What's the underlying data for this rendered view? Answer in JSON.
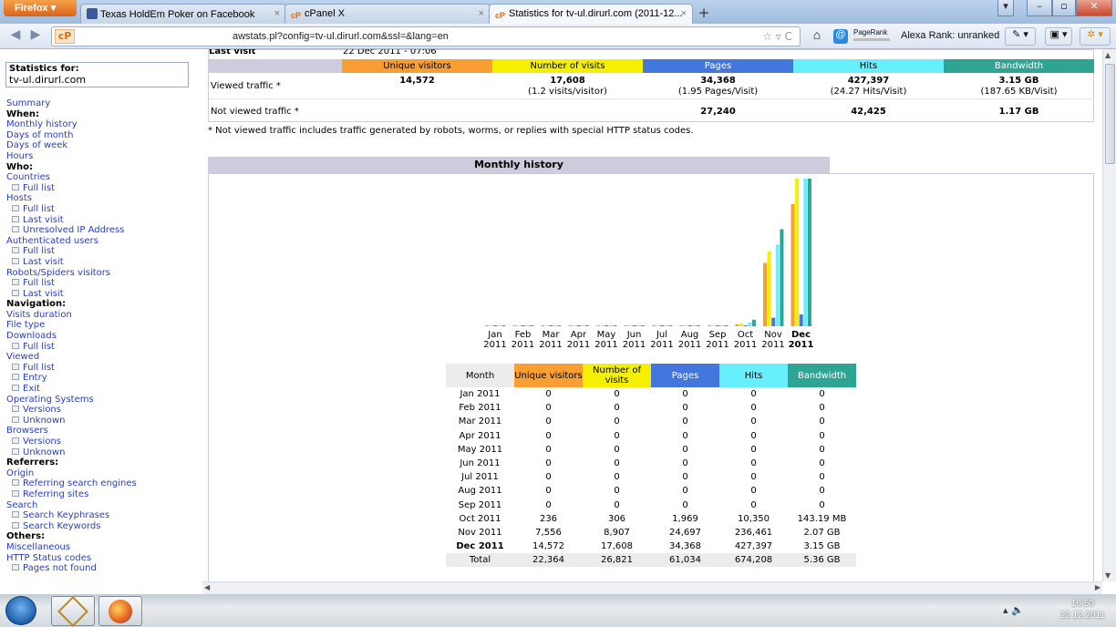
{
  "browser": {
    "app_button": "Firefox",
    "tabs": [
      {
        "label": "Texas HoldEm Poker on Facebook",
        "active": false
      },
      {
        "label": "cPanel X",
        "active": false
      },
      {
        "label": "Statistics for tv-ul.dirurl.com (2011-12...",
        "active": true
      }
    ],
    "url": "awstats.pl?config=tv-ul.dirurl.com&ssl=&lang=en",
    "pagerank_label": "PageRank",
    "alexa_label": "Alexa Rank: unranked"
  },
  "sidebar": {
    "stat_title": "Statistics for:",
    "stat_domain": "tv-ul.dirurl.com",
    "items": [
      {
        "label": "Summary",
        "type": "link"
      },
      {
        "label": "When:",
        "type": "heading"
      },
      {
        "label": "Monthly history",
        "type": "link"
      },
      {
        "label": "Days of month",
        "type": "link"
      },
      {
        "label": "Days of week",
        "type": "link"
      },
      {
        "label": "Hours",
        "type": "link"
      },
      {
        "label": "Who:",
        "type": "heading"
      },
      {
        "label": "Countries",
        "type": "link"
      },
      {
        "label": "Full list",
        "type": "sub"
      },
      {
        "label": "Hosts",
        "type": "link"
      },
      {
        "label": "Full list",
        "type": "sub"
      },
      {
        "label": "Last visit",
        "type": "sub"
      },
      {
        "label": "Unresolved IP Address",
        "type": "sub"
      },
      {
        "label": "Authenticated users",
        "type": "link"
      },
      {
        "label": "Full list",
        "type": "sub"
      },
      {
        "label": "Last visit",
        "type": "sub"
      },
      {
        "label": "Robots/Spiders visitors",
        "type": "link"
      },
      {
        "label": "Full list",
        "type": "sub"
      },
      {
        "label": "Last visit",
        "type": "sub"
      },
      {
        "label": "Navigation:",
        "type": "heading"
      },
      {
        "label": "Visits duration",
        "type": "link"
      },
      {
        "label": "File type",
        "type": "link"
      },
      {
        "label": "Downloads",
        "type": "link"
      },
      {
        "label": "Full list",
        "type": "sub"
      },
      {
        "label": "Viewed",
        "type": "link"
      },
      {
        "label": "Full list",
        "type": "sub"
      },
      {
        "label": "Entry",
        "type": "sub"
      },
      {
        "label": "Exit",
        "type": "sub"
      },
      {
        "label": "Operating Systems",
        "type": "link"
      },
      {
        "label": "Versions",
        "type": "sub"
      },
      {
        "label": "Unknown",
        "type": "sub"
      },
      {
        "label": "Browsers",
        "type": "link"
      },
      {
        "label": "Versions",
        "type": "sub"
      },
      {
        "label": "Unknown",
        "type": "sub"
      },
      {
        "label": "Referrers:",
        "type": "heading"
      },
      {
        "label": "Origin",
        "type": "link"
      },
      {
        "label": "Referring search engines",
        "type": "sub"
      },
      {
        "label": "Referring sites",
        "type": "sub"
      },
      {
        "label": "Search",
        "type": "link"
      },
      {
        "label": "Search Keyphrases",
        "type": "sub"
      },
      {
        "label": "Search Keywords",
        "type": "sub"
      },
      {
        "label": "Others:",
        "type": "heading"
      },
      {
        "label": "Miscellaneous",
        "type": "link"
      },
      {
        "label": "HTTP Status codes",
        "type": "link"
      },
      {
        "label": "Pages not found",
        "type": "sub"
      }
    ]
  },
  "summary": {
    "last_visit_label": "Last visit",
    "last_visit_value": "22 Dec 2011 - 07:06",
    "headers": [
      "Unique visitors",
      "Number of visits",
      "Pages",
      "Hits",
      "Bandwidth"
    ],
    "viewed_label": "Viewed traffic *",
    "viewed": [
      {
        "main": "14,572",
        "sub": ""
      },
      {
        "main": "17,608",
        "sub": "(1.2 visits/visitor)"
      },
      {
        "main": "34,368",
        "sub": "(1.95 Pages/Visit)"
      },
      {
        "main": "427,397",
        "sub": "(24.27 Hits/Visit)"
      },
      {
        "main": "3.15 GB",
        "sub": "(187.65 KB/Visit)"
      }
    ],
    "not_viewed_label": "Not viewed traffic *",
    "not_viewed": [
      "",
      "",
      "27,240",
      "42,425",
      "1.17 GB"
    ],
    "footnote": "* Not viewed traffic includes traffic generated by robots, worms, or replies with special HTTP status codes."
  },
  "colors": {
    "unique": "#f89e33",
    "visits": "#f4f000",
    "pages": "#4477dd",
    "hits": "#66f0ff",
    "bandwidth": "#2ea495",
    "section": "#ccccdd"
  },
  "monthly": {
    "title": "Monthly history",
    "table_headers": [
      "Month",
      "Unique visitors",
      "Number of visits",
      "Pages",
      "Hits",
      "Bandwidth"
    ],
    "rows": [
      {
        "month": "Jan 2011",
        "unique": "0",
        "visits": "0",
        "pages": "0",
        "hits": "0",
        "bw": "0",
        "current": false
      },
      {
        "month": "Feb 2011",
        "unique": "0",
        "visits": "0",
        "pages": "0",
        "hits": "0",
        "bw": "0",
        "current": false
      },
      {
        "month": "Mar 2011",
        "unique": "0",
        "visits": "0",
        "pages": "0",
        "hits": "0",
        "bw": "0",
        "current": false
      },
      {
        "month": "Apr 2011",
        "unique": "0",
        "visits": "0",
        "pages": "0",
        "hits": "0",
        "bw": "0",
        "current": false
      },
      {
        "month": "May 2011",
        "unique": "0",
        "visits": "0",
        "pages": "0",
        "hits": "0",
        "bw": "0",
        "current": false
      },
      {
        "month": "Jun 2011",
        "unique": "0",
        "visits": "0",
        "pages": "0",
        "hits": "0",
        "bw": "0",
        "current": false
      },
      {
        "month": "Jul 2011",
        "unique": "0",
        "visits": "0",
        "pages": "0",
        "hits": "0",
        "bw": "0",
        "current": false
      },
      {
        "month": "Aug 2011",
        "unique": "0",
        "visits": "0",
        "pages": "0",
        "hits": "0",
        "bw": "0",
        "current": false
      },
      {
        "month": "Sep 2011",
        "unique": "0",
        "visits": "0",
        "pages": "0",
        "hits": "0",
        "bw": "0",
        "current": false
      },
      {
        "month": "Oct 2011",
        "unique": "236",
        "visits": "306",
        "pages": "1,969",
        "hits": "10,350",
        "bw": "143.19 MB",
        "current": false
      },
      {
        "month": "Nov 2011",
        "unique": "7,556",
        "visits": "8,907",
        "pages": "24,697",
        "hits": "236,461",
        "bw": "2.07 GB",
        "current": false
      },
      {
        "month": "Dec 2011",
        "unique": "14,572",
        "visits": "17,608",
        "pages": "34,368",
        "hits": "427,397",
        "bw": "3.15 GB",
        "current": true
      }
    ],
    "total": {
      "month": "Total",
      "unique": "22,364",
      "visits": "26,821",
      "pages": "61,034",
      "hits": "674,208",
      "bw": "5.36 GB"
    }
  },
  "chart_data": {
    "type": "bar",
    "categories": [
      "Jan 2011",
      "Feb 2011",
      "Mar 2011",
      "Apr 2011",
      "May 2011",
      "Jun 2011",
      "Jul 2011",
      "Aug 2011",
      "Sep 2011",
      "Oct 2011",
      "Nov 2011",
      "Dec 2011"
    ],
    "month_labels": [
      "Jan",
      "Feb",
      "Mar",
      "Apr",
      "May",
      "Jun",
      "Jul",
      "Aug",
      "Sep",
      "Oct",
      "Nov",
      "Dec"
    ],
    "year_labels": [
      "2011",
      "2011",
      "2011",
      "2011",
      "2011",
      "2011",
      "2011",
      "2011",
      "2011",
      "2011",
      "2011",
      "2011"
    ],
    "series": [
      {
        "name": "Unique visitors",
        "values": [
          0,
          0,
          0,
          0,
          0,
          0,
          0,
          0,
          0,
          236,
          7556,
          14572
        ]
      },
      {
        "name": "Number of visits",
        "values": [
          0,
          0,
          0,
          0,
          0,
          0,
          0,
          0,
          0,
          306,
          8907,
          17608
        ]
      },
      {
        "name": "Pages",
        "values": [
          0,
          0,
          0,
          0,
          0,
          0,
          0,
          0,
          0,
          1969,
          24697,
          34368
        ]
      },
      {
        "name": "Hits",
        "values": [
          0,
          0,
          0,
          0,
          0,
          0,
          0,
          0,
          0,
          10350,
          236461,
          427397
        ]
      },
      {
        "name": "Bandwidth",
        "values": [
          0,
          0,
          0,
          0,
          0,
          0,
          0,
          0,
          0,
          143.19,
          2119.68,
          3225.6
        ]
      }
    ],
    "bandwidth_unit": "MB",
    "highlight_category": "Dec 2011"
  },
  "taskbar": {
    "time": "16:50",
    "date": "22.12.2011"
  }
}
